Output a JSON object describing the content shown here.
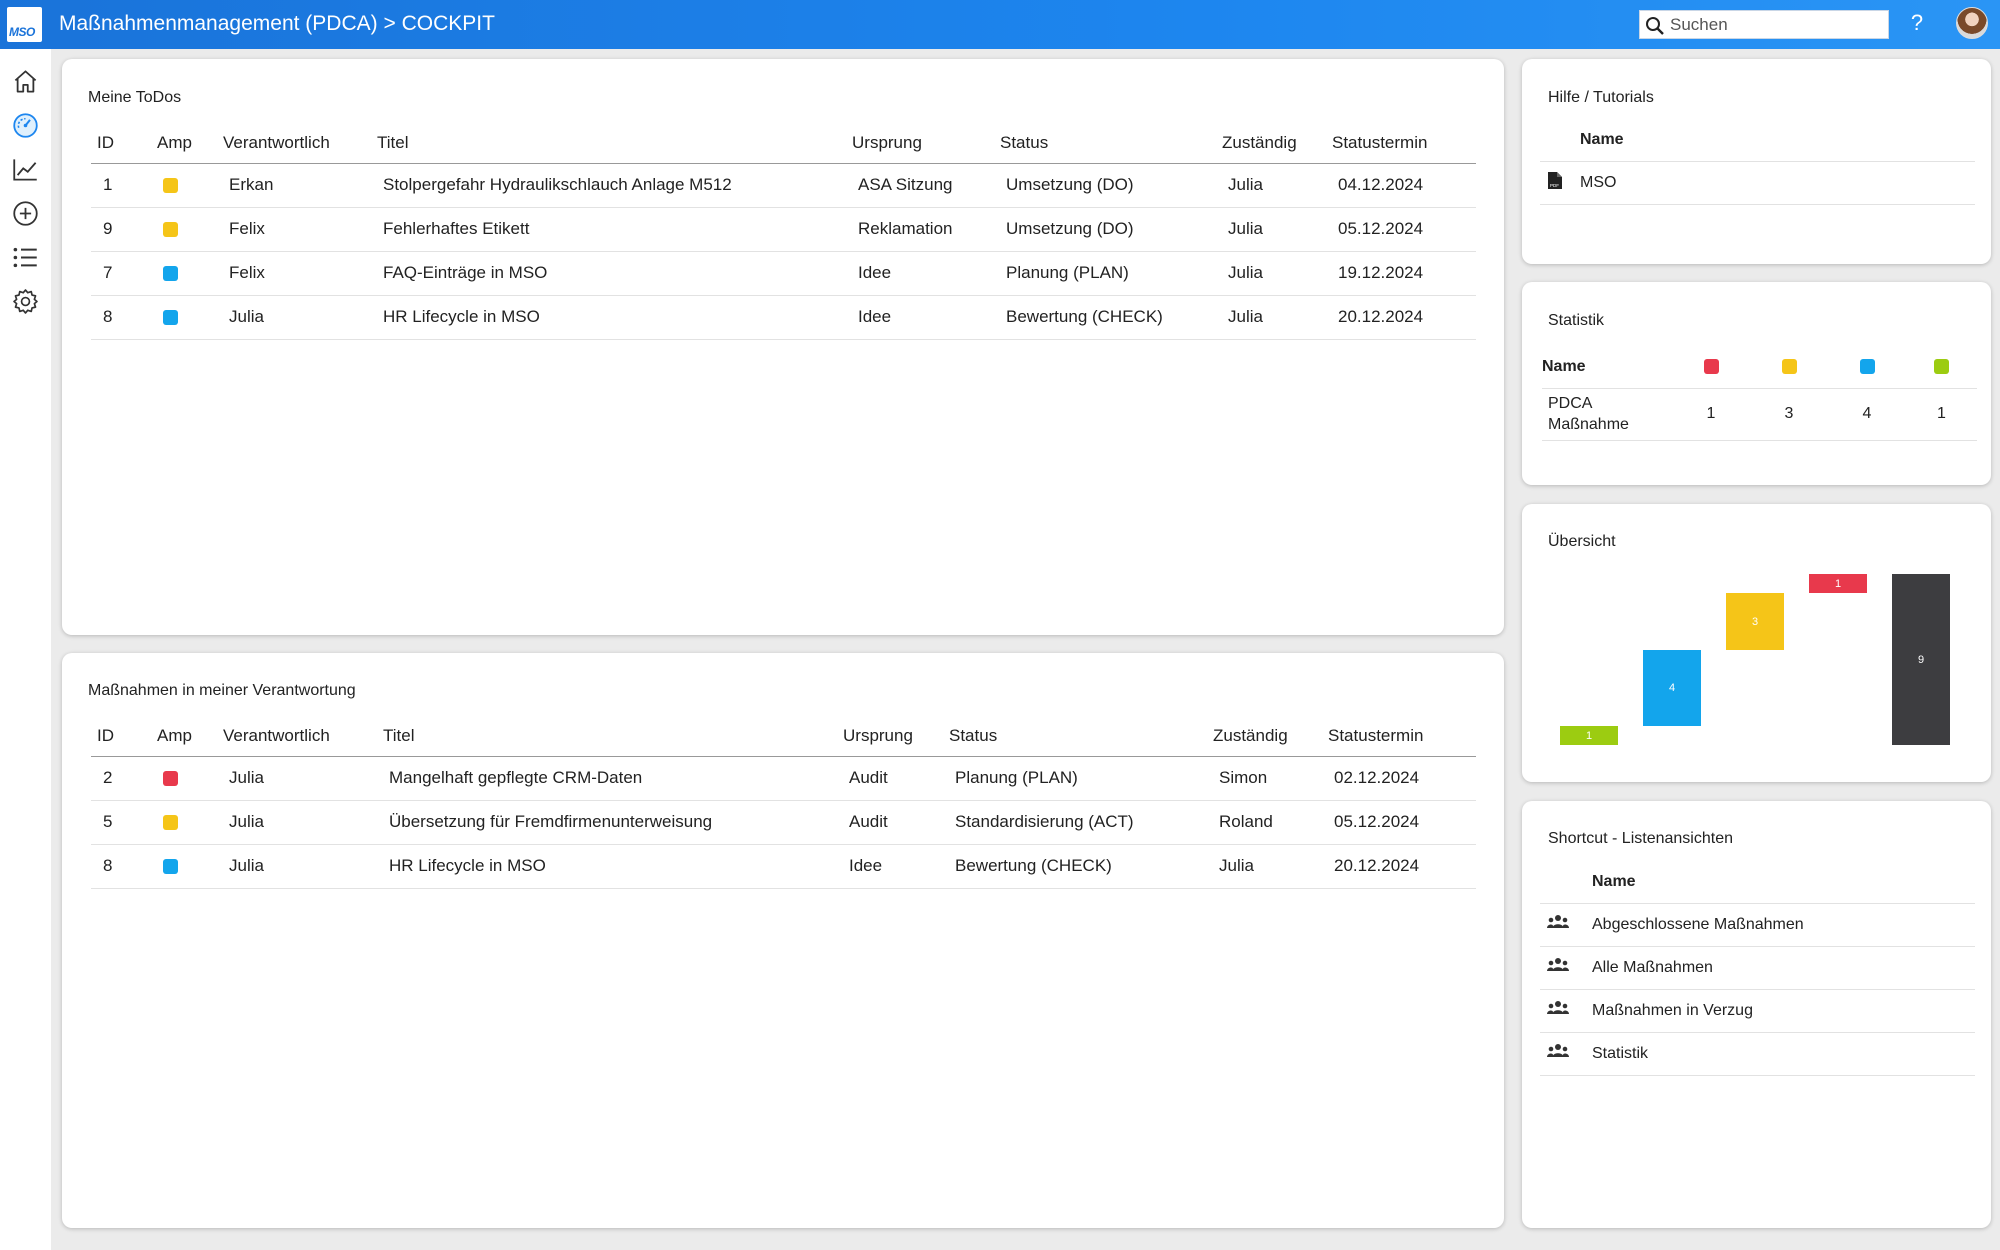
{
  "header": {
    "logo_text": "MSO",
    "title": "Maßnahmenmanagement (PDCA) > COCKPIT",
    "search_placeholder": "Suchen",
    "help_label": "?"
  },
  "sidebar": {
    "items": [
      {
        "icon": "home-icon"
      },
      {
        "icon": "dashboard-icon"
      },
      {
        "icon": "chart-icon"
      },
      {
        "icon": "add-circle-icon"
      },
      {
        "icon": "list-icon"
      },
      {
        "icon": "settings-icon"
      }
    ]
  },
  "colors": {
    "red": "#e8394c",
    "yellow": "#f5c518",
    "blue": "#13a5ec",
    "green": "#9ccc11",
    "dark": "#3d3d40",
    "accent": "#1d86ef"
  },
  "todos": {
    "title": "Meine ToDos",
    "columns": [
      "ID",
      "Amp",
      "Verantwortlich",
      "Titel",
      "Ursprung",
      "Status",
      "Zuständig",
      "Statustermin"
    ],
    "rows": [
      {
        "id": "1",
        "amp": "yellow",
        "verantwortlich": "Erkan",
        "titel": "Stolpergefahr Hydraulikschlauch Anlage M512",
        "ursprung": "ASA Sitzung",
        "status": "Umsetzung (DO)",
        "zustaendig": "Julia",
        "termin": "04.12.2024"
      },
      {
        "id": "9",
        "amp": "yellow",
        "verantwortlich": "Felix",
        "titel": "Fehlerhaftes Etikett",
        "ursprung": "Reklamation",
        "status": "Umsetzung (DO)",
        "zustaendig": "Julia",
        "termin": "05.12.2024"
      },
      {
        "id": "7",
        "amp": "blue",
        "verantwortlich": "Felix",
        "titel": "FAQ-Einträge in MSO",
        "ursprung": "Idee",
        "status": "Planung (PLAN)",
        "zustaendig": "Julia",
        "termin": "19.12.2024"
      },
      {
        "id": "8",
        "amp": "blue",
        "verantwortlich": "Julia",
        "titel": "HR Lifecycle in MSO",
        "ursprung": "Idee",
        "status": "Bewertung (CHECK)",
        "zustaendig": "Julia",
        "termin": "20.12.2024"
      }
    ]
  },
  "responsibility": {
    "title": "Maßnahmen in meiner Verantwortung",
    "columns": [
      "ID",
      "Amp",
      "Verantwortlich",
      "Titel",
      "Ursprung",
      "Status",
      "Zuständig",
      "Statustermin"
    ],
    "rows": [
      {
        "id": "2",
        "amp": "red",
        "verantwortlich": "Julia",
        "titel": "Mangelhaft gepflegte CRM-Daten",
        "ursprung": "Audit",
        "status": "Planung (PLAN)",
        "zustaendig": "Simon",
        "termin": "02.12.2024"
      },
      {
        "id": "5",
        "amp": "yellow",
        "verantwortlich": "Julia",
        "titel": "Übersetzung für Fremdfirmenunterweisung",
        "ursprung": "Audit",
        "status": "Standardisierung (ACT)",
        "zustaendig": "Roland",
        "termin": "05.12.2024"
      },
      {
        "id": "8",
        "amp": "blue",
        "verantwortlich": "Julia",
        "titel": "HR Lifecycle in MSO",
        "ursprung": "Idee",
        "status": "Bewertung (CHECK)",
        "zustaendig": "Julia",
        "termin": "20.12.2024"
      }
    ]
  },
  "help": {
    "title": "Hilfe / Tutorials",
    "column": "Name",
    "items": [
      {
        "icon": "pdf-file-icon",
        "label": "MSO"
      }
    ]
  },
  "statistik": {
    "title": "Statistik",
    "column": "Name",
    "color_columns": [
      "red",
      "yellow",
      "blue",
      "green"
    ],
    "rows": [
      {
        "name": "PDCA Maßnahme",
        "values": [
          "1",
          "3",
          "4",
          "1"
        ]
      }
    ]
  },
  "uebersicht": {
    "title": "Übersicht",
    "chart_data": {
      "type": "bar",
      "categories": [
        "green",
        "blue",
        "yellow",
        "red",
        "total"
      ],
      "values": [
        1,
        4,
        3,
        1,
        9
      ],
      "colors": [
        "#9ccc11",
        "#13a5ec",
        "#f5c518",
        "#e8394c",
        "#3d3d40"
      ],
      "labels": [
        "1",
        "4",
        "3",
        "1",
        "9"
      ],
      "style": "waterfall"
    }
  },
  "shortcuts": {
    "title": "Shortcut - Listenansichten",
    "column": "Name",
    "items": [
      {
        "icon": "users-icon",
        "label": "Abgeschlossene Maßnahmen"
      },
      {
        "icon": "users-icon",
        "label": "Alle Maßnahmen"
      },
      {
        "icon": "users-icon",
        "label": "Maßnahmen in Verzug"
      },
      {
        "icon": "users-icon",
        "label": "Statistik"
      }
    ]
  }
}
